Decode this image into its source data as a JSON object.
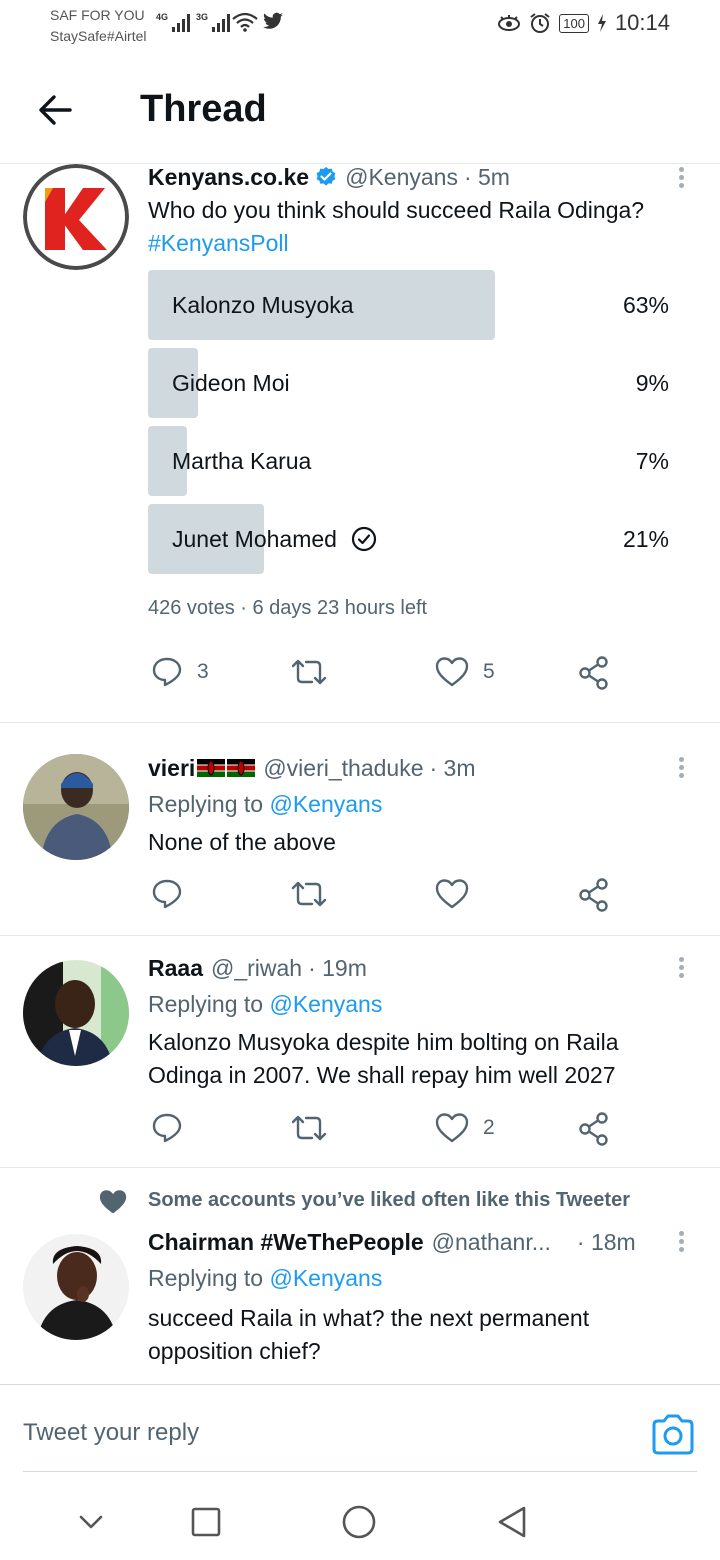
{
  "status_bar": {
    "carrier_line1": "SAF FOR YOU",
    "carrier_line2": "StaySafe#Airtel",
    "network1": "4G",
    "network2": "3G",
    "battery": "100",
    "time": "10:14"
  },
  "header": {
    "title": "Thread"
  },
  "main_tweet": {
    "name": "Kenyans.co.ke",
    "handle": "@Kenyans",
    "time": "· 5m",
    "text": "Who do you think should succeed Raila Odinga?",
    "hashtag": "#KenyansPoll",
    "poll": [
      {
        "label": "Kalonzo Musyoka",
        "percent": "63%",
        "fraction": 0.63,
        "voted": false
      },
      {
        "label": "Gideon Moi",
        "percent": "9%",
        "fraction": 0.09,
        "voted": false
      },
      {
        "label": "Martha Karua",
        "percent": "7%",
        "fraction": 0.07,
        "voted": false
      },
      {
        "label": "Junet Mohamed",
        "percent": "21%",
        "fraction": 0.21,
        "voted": true
      }
    ],
    "poll_meta": "426 votes · 6 days 23 hours left",
    "reply_count": "3",
    "like_count": "5"
  },
  "replies": [
    {
      "name": "vieri",
      "handle": "@vieri_thaduke",
      "time": "· 3m",
      "replying_prefix": "Replying to",
      "replying_to": "@Kenyans",
      "text": "None of the above"
    },
    {
      "name": "Raaa",
      "handle": "@_riwah",
      "time": "· 19m",
      "replying_prefix": "Replying to",
      "replying_to": "@Kenyans",
      "text_line1": "Kalonzo Musyoka despite him bolting on Raila",
      "text_line2": "Odinga in 2007. We shall repay him well 2027",
      "like_count": "2"
    },
    {
      "social_context": "Some accounts you’ve liked often like this Tweeter",
      "name": "Chairman #WeThePeople",
      "handle": "@nathanr...",
      "time": "· 18m",
      "replying_prefix": "Replying to",
      "replying_to": "@Kenyans",
      "text_line1": "succeed Raila in what? the next permanent",
      "text_line2": "opposition chief?"
    }
  ],
  "reply_bar": {
    "placeholder": "Tweet your reply"
  },
  "colors": {
    "accent": "#1d9bf0",
    "poll_bar": "#cfd9de",
    "brand_red": "#e1231f"
  }
}
